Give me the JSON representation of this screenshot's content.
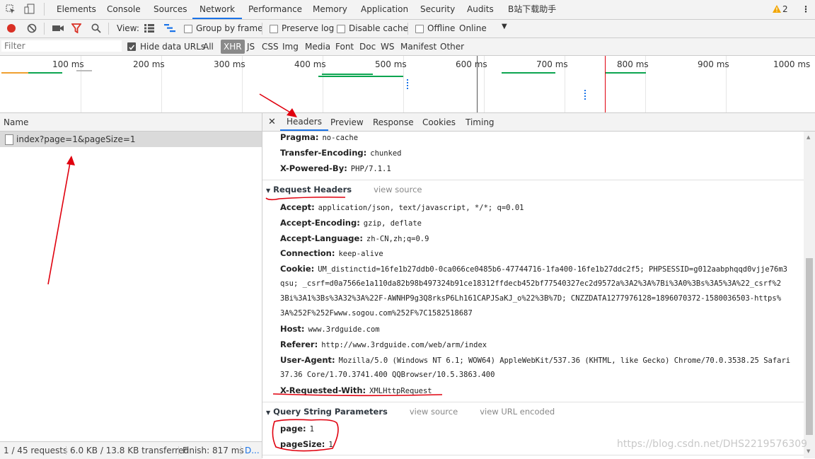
{
  "tabs": {
    "items": [
      "Elements",
      "Console",
      "Sources",
      "Network",
      "Performance",
      "Memory",
      "Application",
      "Security",
      "Audits",
      "B站下载助手"
    ],
    "active": "Network",
    "warning_count": "2"
  },
  "toolbar": {
    "view_label": "View:",
    "group_by_frame": "Group by frame",
    "preserve_log": "Preserve log",
    "disable_cache": "Disable cache",
    "offline": "Offline",
    "online": "Online"
  },
  "filter": {
    "placeholder": "Filter",
    "hide_data_urls": "Hide data URLs",
    "types": [
      "All",
      "XHR",
      "JS",
      "CSS",
      "Img",
      "Media",
      "Font",
      "Doc",
      "WS",
      "Manifest",
      "Other"
    ],
    "active_type": "XHR"
  },
  "timeline": {
    "ticks": [
      "100 ms",
      "200 ms",
      "300 ms",
      "400 ms",
      "500 ms",
      "600 ms",
      "700 ms",
      "800 ms",
      "900 ms",
      "1000 ms"
    ]
  },
  "requests": {
    "column_name": "Name",
    "rows": [
      {
        "name": "index?page=1&pageSize=1"
      }
    ],
    "footer": {
      "requests": "1 / 45 requests",
      "transferred": "6.0 KB / 13.8 KB transferred",
      "finish": "Finish: 817 ms",
      "more": "D..."
    }
  },
  "detail": {
    "tabs": [
      "Headers",
      "Preview",
      "Response",
      "Cookies",
      "Timing"
    ],
    "active_tab": "Headers",
    "response_headers": [
      {
        "name": "Pragma:",
        "value": "no-cache"
      },
      {
        "name": "Transfer-Encoding:",
        "value": "chunked"
      },
      {
        "name": "X-Powered-By:",
        "value": "PHP/7.1.1"
      }
    ],
    "request_headers_title": "Request Headers",
    "view_source": "view source",
    "request_headers": [
      {
        "name": "Accept:",
        "value": "application/json, text/javascript, */*; q=0.01"
      },
      {
        "name": "Accept-Encoding:",
        "value": "gzip, deflate"
      },
      {
        "name": "Accept-Language:",
        "value": "zh-CN,zh;q=0.9"
      },
      {
        "name": "Connection:",
        "value": "keep-alive"
      },
      {
        "name": "Cookie:",
        "value": "UM_distinctid=16fe1b27ddb0-0ca066ce0485b6-47744716-1fa400-16fe1b27ddc2f5; PHPSESSID=g012aabphqqd0vjje76m3"
      },
      {
        "name": "",
        "value": "qsu; _csrf=d0a7566e1a110da82b98b497324b91ce18312ffdecb452bf77540327ec2d9572a%3A2%3A%7Bi%3A0%3Bs%3A5%3A%22_csrf%2"
      },
      {
        "name": "",
        "value": "3Bi%3A1%3Bs%3A32%3A%22F-AWNHP9g3Q8rksP6Lh161CAPJSaKJ_o%22%3B%7D; CNZZDATA1277976128=1896070372-1580036503-https%"
      },
      {
        "name": "",
        "value": "3A%252F%252Fwww.sogou.com%252F%7C1582518687"
      },
      {
        "name": "Host:",
        "value": "www.3rdguide.com"
      },
      {
        "name": "Referer:",
        "value": "http://www.3rdguide.com/web/arm/index"
      },
      {
        "name": "User-Agent:",
        "value": "Mozilla/5.0 (Windows NT 6.1; WOW64) AppleWebKit/537.36 (KHTML, like Gecko) Chrome/70.0.3538.25 Safari"
      },
      {
        "name": "",
        "value": "37.36 Core/1.70.3741.400 QQBrowser/10.5.3863.400"
      },
      {
        "name": "X-Requested-With:",
        "value": "XMLHttpRequest"
      }
    ],
    "query_title": "Query String Parameters",
    "view_url_encoded": "view URL encoded",
    "query_params": [
      {
        "name": "page:",
        "value": "1"
      },
      {
        "name": "pageSize:",
        "value": "1"
      }
    ]
  },
  "watermark": "https://blog.csdn.net/DHS2219576309",
  "colors": {
    "accent": "#1a73e8",
    "record": "#d93025",
    "annotation": "#e0000e",
    "bar_green": "#0ca550",
    "bar_orange": "#f0a030"
  }
}
